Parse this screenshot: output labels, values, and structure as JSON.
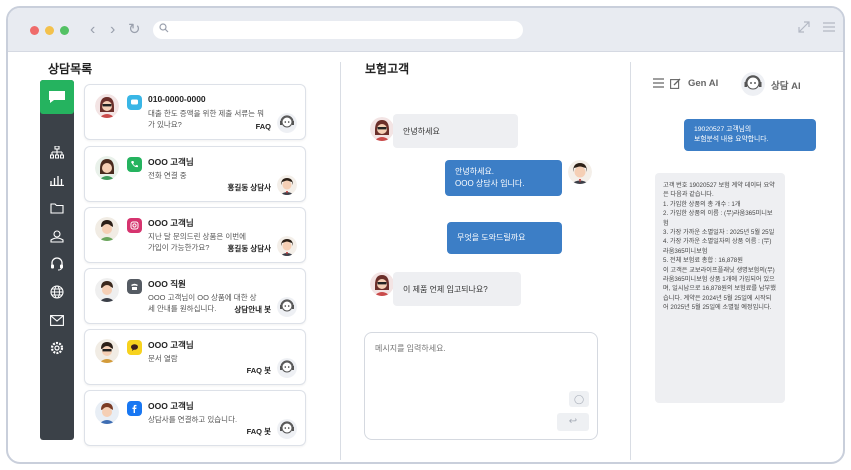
{
  "colors": {
    "accent_green": "#25b35f",
    "bubble_blue": "#3c7ec6",
    "sidebar_dark": "#3b4148",
    "dot_red": "#ef6b6b",
    "dot_yellow": "#f3c14c",
    "dot_green": "#53c164"
  },
  "browser": {
    "back_icon": "chevron-left-icon",
    "forward_icon": "chevron-right-icon",
    "reload_icon": "reload-icon",
    "search_icon": "search-icon",
    "expand_icon": "expand-icon",
    "menu_icon": "hamburger-menu-icon"
  },
  "list": {
    "title": "상담목록"
  },
  "sidebar": {
    "items": [
      {
        "icon": "chat-icon",
        "active": true
      },
      {
        "icon": "org-chart-icon"
      },
      {
        "icon": "bar-chart-icon"
      },
      {
        "icon": "folder-icon"
      },
      {
        "icon": "user-icon"
      },
      {
        "icon": "headset-icon"
      },
      {
        "icon": "globe-icon"
      },
      {
        "icon": "mail-icon"
      },
      {
        "icon": "settings-icon"
      }
    ]
  },
  "cards": [
    {
      "name": "010-0000-0000",
      "msg": "대출 한도 증액을 위한 제출 서류는 뭐가 있나요?",
      "tag": "FAQ",
      "channel": "sms-icon",
      "channel_color": "#39b6e6"
    },
    {
      "name": "OOO 고객님",
      "msg": "전화 연결 중",
      "tag": "홍길동 상담사",
      "channel": "phone-icon",
      "channel_color": "#25b35f"
    },
    {
      "name": "OOO 고객님",
      "msg": "지난 달 문의드린 상품은 이번에 가입이 가능한가요?",
      "tag": "홍길동 상담사",
      "channel": "instagram-icon",
      "channel_color": "#d6346f"
    },
    {
      "name": "OOO 직원",
      "msg": "OOO 고객님이 OO 상품에 대한 상세 안내를 원하십니다.",
      "tag": "상담안내 봇",
      "channel": "telephone-icon",
      "channel_color": "#555b63"
    },
    {
      "name": "OOO 고객님",
      "msg": "문서 열람",
      "tag": "FAQ 봇",
      "channel": "kakaotalk-icon",
      "channel_color": "#f7d21e"
    },
    {
      "name": "OOO 고객님",
      "msg": "상담사를 연결하고 있습니다.",
      "tag": "FAQ 봇",
      "channel": "facebook-icon",
      "channel_color": "#1877f2"
    }
  ],
  "chat": {
    "title": "보험고객",
    "messages": [
      {
        "side": "left",
        "text": "안녕하세요"
      },
      {
        "side": "right",
        "text": "안녕하세요.\nOOO 상담사 입니다."
      },
      {
        "side": "right",
        "text": "무엇을 도와드릴까요"
      },
      {
        "side": "left",
        "text": "이 제품 언제 입고되나요?"
      }
    ],
    "input_placeholder": "메시지를 입력하세요.",
    "attach_icon": "attach-icon",
    "send_icon": "send-icon"
  },
  "ai": {
    "menu_icon": "list-icon",
    "edit_icon": "edit-icon",
    "genai_label": "Gen AI",
    "consult_label": "상담 AI",
    "request": "19020527 고객님의\n보험분석 내용 요약합니다.",
    "summary": "고객 번호 19020527 보험 계약 데이터 요약은 다음과 같습니다.\n1. 가입한 상품의 총 개수 : 1개\n2. 가입한 상품의 이름 : (무)라움365미니보험\n3. 가장 가까운 소멸일자 : 2025년 5월 25일\n4. 가장 가까운 소멸일자의 상품 이름 : (무)라움365미니보험\n5. 전체 보험료 총합 : 16,878원\n이 고객은 교보라이프플래닛 생명보험의(무)라움365미니보험 상품 1개에 가입되어 있으며, 일시납으로 16,878원의 보험료를 납부했습니다. 계약은 2024년 5월 25일에 시작되어 2025년 5월 25일에 소멸될 예정입니다."
  }
}
